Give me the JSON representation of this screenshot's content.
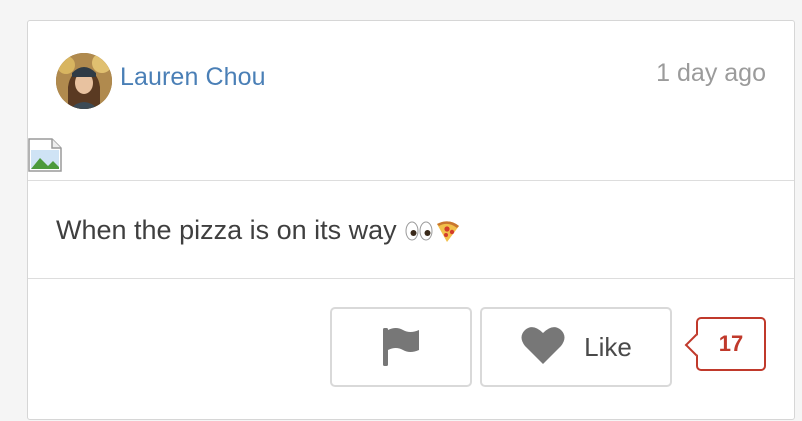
{
  "post": {
    "author": "Lauren Chou",
    "timestamp": "1 day ago",
    "text": "When the pizza is on its way",
    "emojis": [
      "eyes-emoji",
      "pizza-emoji"
    ]
  },
  "actions": {
    "flag_icon": "flag-icon",
    "like_label": "Like",
    "like_count": "17"
  },
  "colors": {
    "author_link": "#4a7fb6",
    "timestamp": "#9b9b9b",
    "like_count": "#c0392b"
  }
}
